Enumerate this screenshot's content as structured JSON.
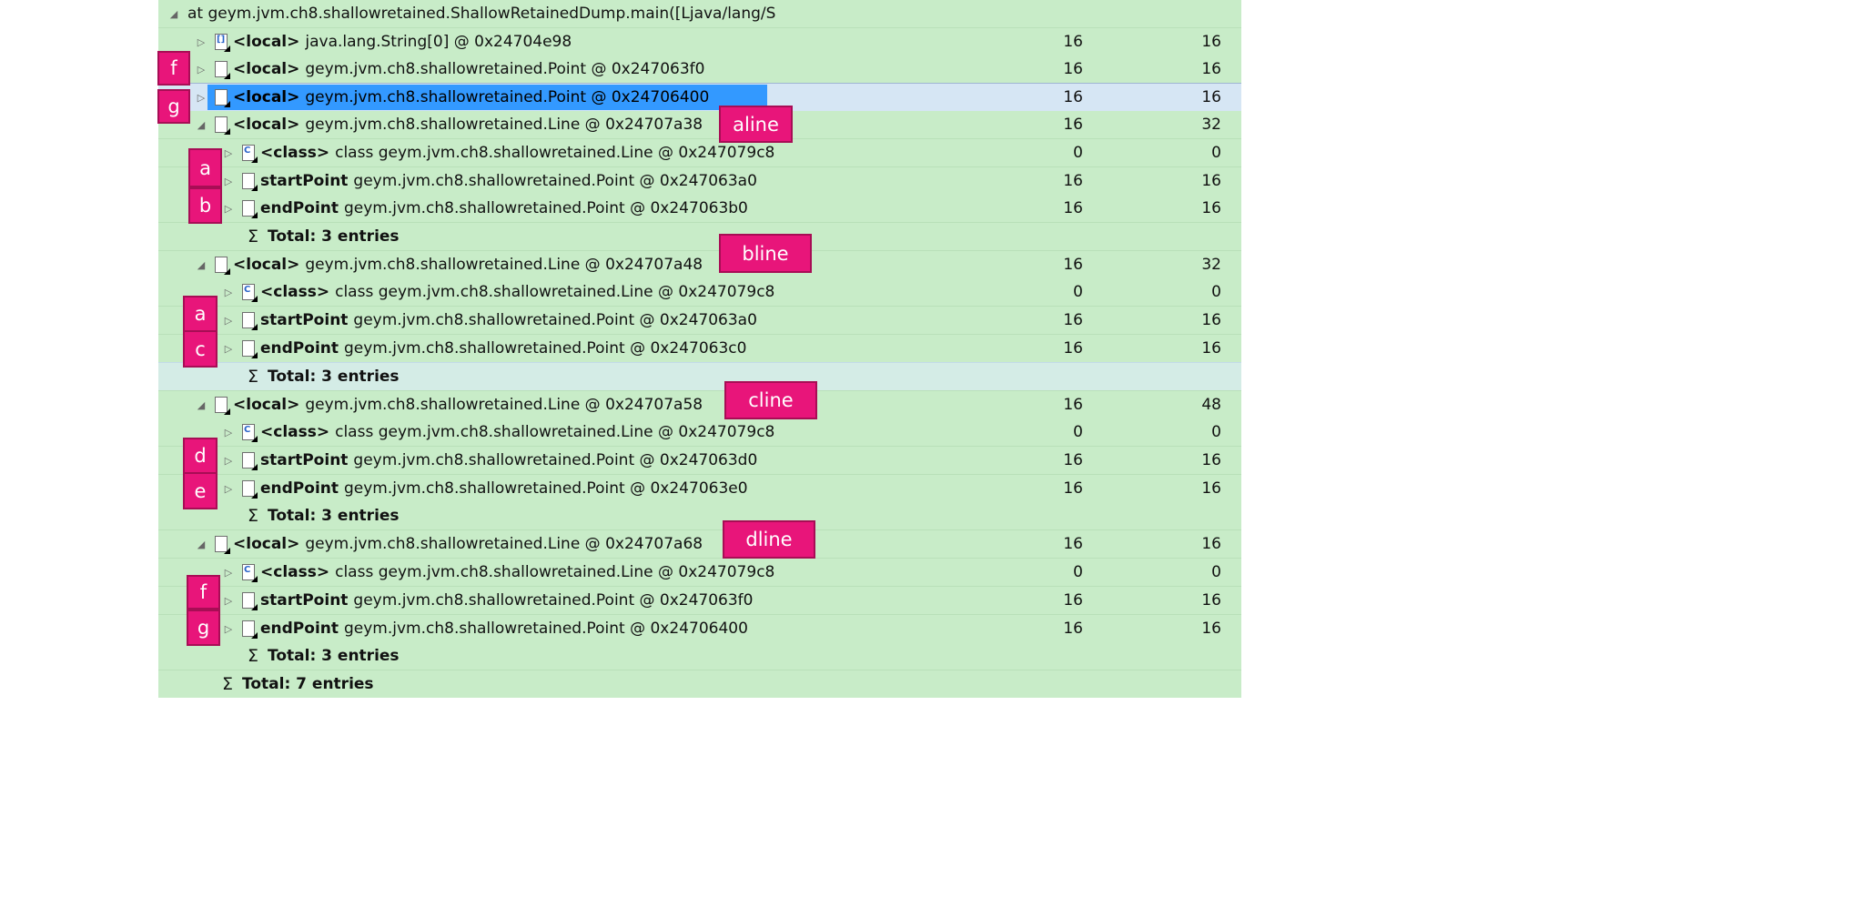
{
  "rows": [
    {
      "name_prefix": "at geym.jvm.ch8.shallowretained.ShallowRetainedDump.main([Ljava/lang/S",
      "keyword": "",
      "name": "",
      "shallow": "",
      "retained": ""
    },
    {
      "keyword": "<local>",
      "name": "java.lang.String[0] @ 0x24704e98",
      "shallow": "16",
      "retained": "16"
    },
    {
      "keyword": "<local>",
      "name": "geym.jvm.ch8.shallowretained.Point @ 0x247063f0",
      "shallow": "16",
      "retained": "16"
    },
    {
      "keyword": "<local>",
      "name": "geym.jvm.ch8.shallowretained.Point @ 0x24706400",
      "shallow": "16",
      "retained": "16"
    },
    {
      "keyword": "<local>",
      "name": "geym.jvm.ch8.shallowretained.Line @ 0x24707a38",
      "shallow": "16",
      "retained": "32"
    },
    {
      "keyword": "<class>",
      "name": "class geym.jvm.ch8.shallowretained.Line @ 0x247079c8",
      "shallow": "0",
      "retained": "0"
    },
    {
      "keyword": "startPoint",
      "name": "geym.jvm.ch8.shallowretained.Point @ 0x247063a0",
      "shallow": "16",
      "retained": "16"
    },
    {
      "keyword": "endPoint",
      "name": "geym.jvm.ch8.shallowretained.Point @ 0x247063b0",
      "shallow": "16",
      "retained": "16"
    },
    {
      "total": "Total: 3 entries"
    },
    {
      "keyword": "<local>",
      "name": "geym.jvm.ch8.shallowretained.Line @ 0x24707a48",
      "shallow": "16",
      "retained": "32"
    },
    {
      "keyword": "<class>",
      "name": "class geym.jvm.ch8.shallowretained.Line @ 0x247079c8",
      "shallow": "0",
      "retained": "0"
    },
    {
      "keyword": "startPoint",
      "name": "geym.jvm.ch8.shallowretained.Point @ 0x247063a0",
      "shallow": "16",
      "retained": "16"
    },
    {
      "keyword": "endPoint",
      "name": "geym.jvm.ch8.shallowretained.Point @ 0x247063c0",
      "shallow": "16",
      "retained": "16"
    },
    {
      "total": "Total: 3 entries"
    },
    {
      "keyword": "<local>",
      "name": "geym.jvm.ch8.shallowretained.Line @ 0x24707a58",
      "shallow": "16",
      "retained": "48"
    },
    {
      "keyword": "<class>",
      "name": "class geym.jvm.ch8.shallowretained.Line @ 0x247079c8",
      "shallow": "0",
      "retained": "0"
    },
    {
      "keyword": "startPoint",
      "name": "geym.jvm.ch8.shallowretained.Point @ 0x247063d0",
      "shallow": "16",
      "retained": "16"
    },
    {
      "keyword": "endPoint",
      "name": "geym.jvm.ch8.shallowretained.Point @ 0x247063e0",
      "shallow": "16",
      "retained": "16"
    },
    {
      "total": "Total: 3 entries"
    },
    {
      "keyword": "<local>",
      "name": "geym.jvm.ch8.shallowretained.Line @ 0x24707a68",
      "shallow": "16",
      "retained": "16"
    },
    {
      "keyword": "<class>",
      "name": "class geym.jvm.ch8.shallowretained.Line @ 0x247079c8",
      "shallow": "0",
      "retained": "0"
    },
    {
      "keyword": "startPoint",
      "name": "geym.jvm.ch8.shallowretained.Point @ 0x247063f0",
      "shallow": "16",
      "retained": "16"
    },
    {
      "keyword": "endPoint",
      "name": "geym.jvm.ch8.shallowretained.Point @ 0x24706400",
      "shallow": "16",
      "retained": "16"
    },
    {
      "total": "Total: 3 entries"
    },
    {
      "total": "Total: 7 entries"
    }
  ],
  "annotations": {
    "f_top": "f",
    "g_top": "g",
    "aline": "aline",
    "a1": "a",
    "b": "b",
    "bline": "bline",
    "a2": "a",
    "c": "c",
    "cline": "cline",
    "d": "d",
    "e": "e",
    "dline": "dline",
    "f": "f",
    "g": "g"
  },
  "colors": {
    "tree_bg": "#c8ecc8",
    "selection": "#3399ff",
    "annotation": "#e8157a"
  },
  "icons": {
    "expanded": "expanded-triangle-icon",
    "collapsed": "collapsed-triangle-icon",
    "object": "object-icon",
    "array": "array-icon",
    "class": "class-icon",
    "sum": "sigma-icon"
  }
}
